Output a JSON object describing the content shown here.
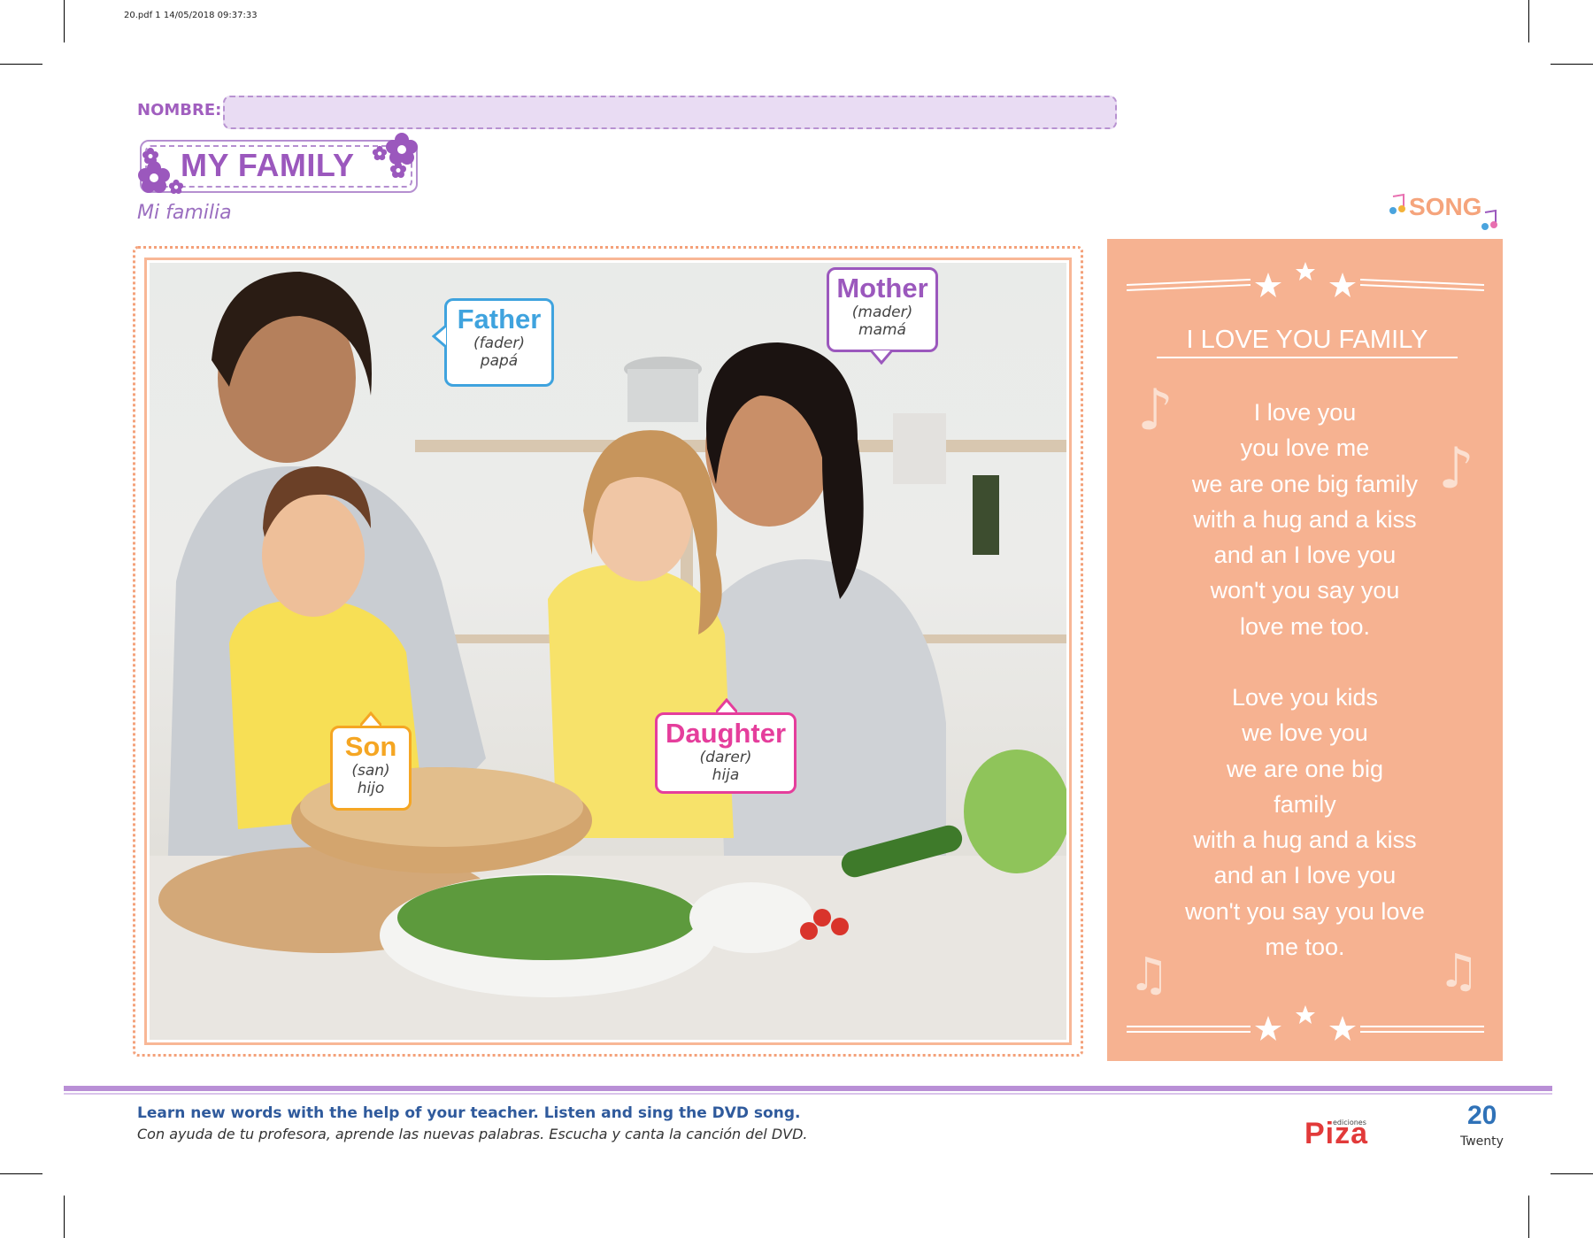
{
  "print_header": "20.pdf   1   14/05/2018   09:37:33",
  "nombre": {
    "label": "NOMBRE:",
    "value": ""
  },
  "title": "MY FAMILY",
  "subtitle": "Mi familia",
  "bubbles": {
    "father": {
      "word": "Father",
      "pron": "(fader)",
      "es": "papá",
      "color": "#3fa3de"
    },
    "mother": {
      "word": "Mother",
      "pron": "(mader)",
      "es": "mamá",
      "color": "#9b58bd"
    },
    "son": {
      "word": "Son",
      "pron": "(san)",
      "es": "hijo",
      "color": "#f5a623"
    },
    "daughter": {
      "word": "Daughter",
      "pron": "(darer)",
      "es": "hija",
      "color": "#e53e9c"
    }
  },
  "song": {
    "tag": "SONG",
    "title": "I LOVE YOU FAMILY",
    "verse1": [
      "I love you",
      "you love me",
      "we are one big family",
      "with a hug and a kiss",
      "and an I love you",
      "won't you say you",
      "love me too."
    ],
    "verse2": [
      "Love you kids",
      "we love you",
      "we are one big",
      "family",
      "with a hug and a kiss",
      "and an I love you",
      "won't you say you love",
      "me too."
    ],
    "color": "#f6b291"
  },
  "footer": {
    "instruction_en": "Learn new words with the help of your teacher. Listen and sing the DVD song.",
    "instruction_es": "Con ayuda de tu profesora, aprende las nuevas palabras. Escucha y canta la canción del DVD.",
    "brand_small": "ediciones",
    "brand": "Piza",
    "page_number": "20",
    "page_word": "Twenty"
  },
  "icons": [
    "flower-icon",
    "music-note-icon",
    "star-icon"
  ]
}
